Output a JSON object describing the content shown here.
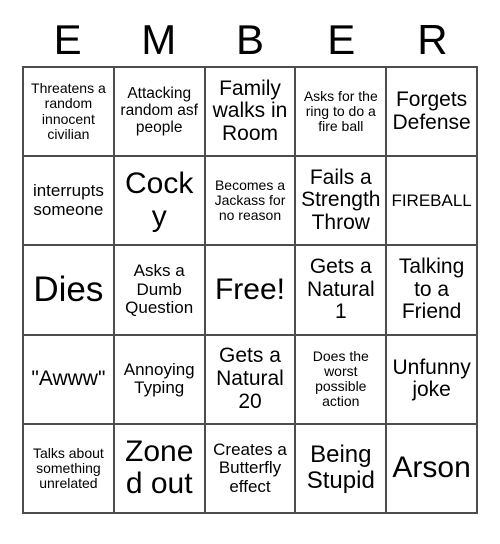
{
  "card": {
    "header_letters": [
      "E",
      "M",
      "B",
      "E",
      "R"
    ],
    "rows": [
      [
        {
          "text": "Threatens a random innocent civilian",
          "size": "fs-xs"
        },
        {
          "text": "Attacking random asf people",
          "size": "fs-s"
        },
        {
          "text": "Family walks in Room",
          "size": "fs-l"
        },
        {
          "text": "Asks for the ring to do a fire ball",
          "size": "fs-xs"
        },
        {
          "text": "Forgets Defense",
          "size": "fs-l"
        }
      ],
      [
        {
          "text": "interrupts someone",
          "size": "fs-m"
        },
        {
          "text": "Cocky",
          "size": "fs-xxl"
        },
        {
          "text": "Becomes a Jackass for no reason",
          "size": "fs-xs"
        },
        {
          "text": "Fails a Strength Throw",
          "size": "fs-l"
        },
        {
          "text": "FIREBALL",
          "size": "fs-m"
        }
      ],
      [
        {
          "text": "Dies",
          "size": "fs-huge"
        },
        {
          "text": "Asks a Dumb Question",
          "size": "fs-m"
        },
        {
          "text": "Free!",
          "size": "fs-xxl"
        },
        {
          "text": "Gets a Natural 1",
          "size": "fs-l"
        },
        {
          "text": "Talking to a Friend",
          "size": "fs-l"
        }
      ],
      [
        {
          "text": "\"Awww\"",
          "size": "fs-l"
        },
        {
          "text": "Annoying Typing",
          "size": "fs-m"
        },
        {
          "text": "Gets a Natural 20",
          "size": "fs-l"
        },
        {
          "text": "Does the worst possible action",
          "size": "fs-xs"
        },
        {
          "text": "Unfunny joke",
          "size": "fs-l"
        }
      ],
      [
        {
          "text": "Talks about something unrelated",
          "size": "fs-xs"
        },
        {
          "text": "Zoned out",
          "size": "fs-xxl"
        },
        {
          "text": "Creates a Butterfly effect",
          "size": "fs-m"
        },
        {
          "text": "Being Stupid",
          "size": "fs-xl"
        },
        {
          "text": "Arson",
          "size": "fs-xxl"
        }
      ]
    ]
  },
  "colors": {
    "background": "#ffffff",
    "text": "#000000",
    "grid_line": "#4d4d4d"
  }
}
